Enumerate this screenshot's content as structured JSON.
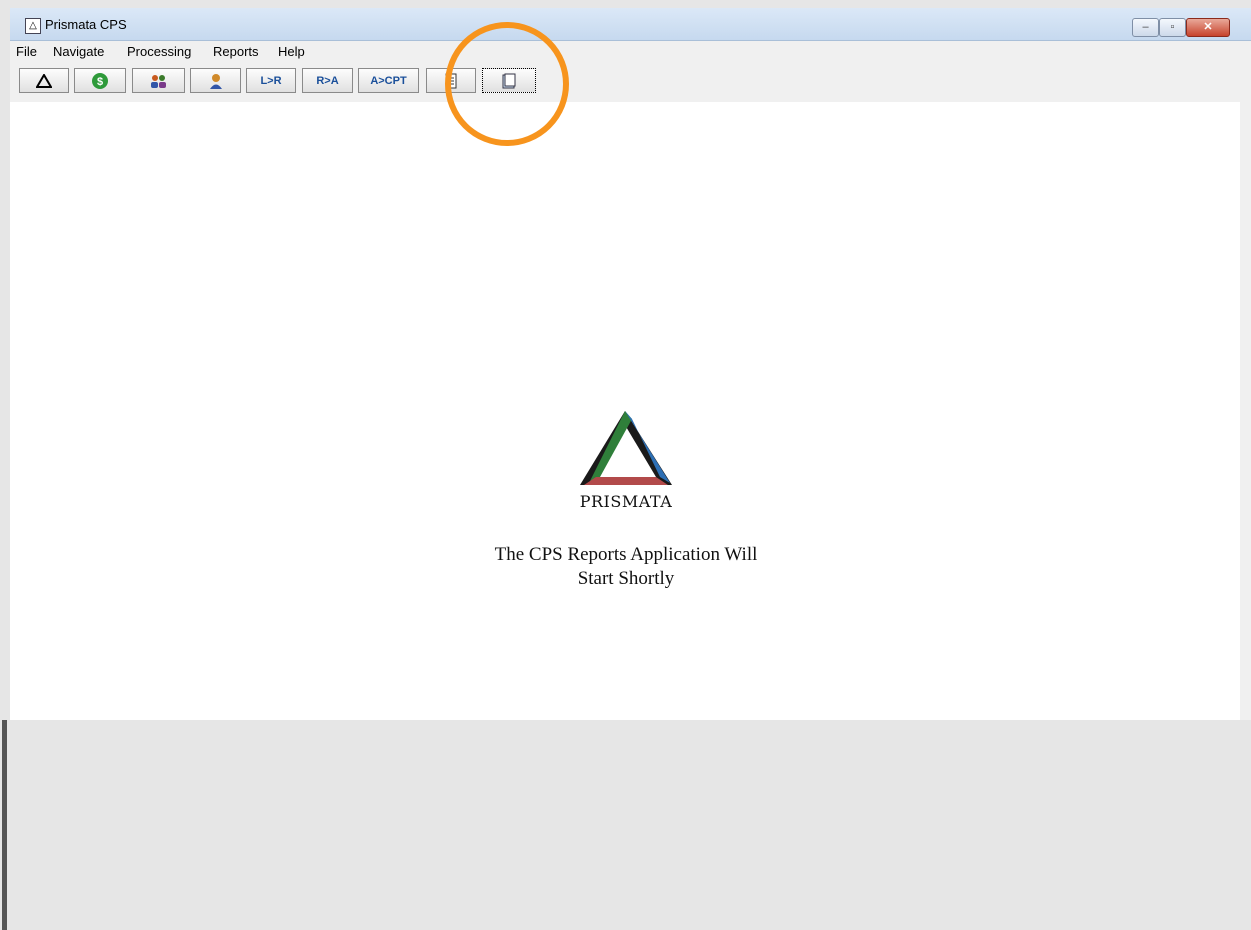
{
  "window": {
    "title": "Prismata CPS",
    "app_icon": "prismata-icon"
  },
  "window_controls": {
    "minimize": "minimize-icon",
    "maximize": "maximize-icon",
    "close": "close-icon"
  },
  "menu": [
    "File",
    "Navigate",
    "Processing",
    "Reports",
    "Help"
  ],
  "toolbar": [
    {
      "id": "prismata",
      "icon": "triangle-icon",
      "label": ""
    },
    {
      "id": "billing",
      "icon": "dollar-icon",
      "label": ""
    },
    {
      "id": "patients",
      "icon": "users-icon",
      "label": ""
    },
    {
      "id": "physicians",
      "icon": "person-icon",
      "label": ""
    },
    {
      "id": "l-to-r",
      "label": "L>R"
    },
    {
      "id": "r-to-a",
      "label": "R>A"
    },
    {
      "id": "a-to-cpt",
      "label": "A>CPT"
    },
    {
      "id": "doc1",
      "icon": "document-icon",
      "label": ""
    },
    {
      "id": "doc2",
      "icon": "page-icon",
      "label": ""
    }
  ],
  "splash": {
    "logo_text": "PRISMATA",
    "message_line1": "The CPS Reports Application Will",
    "message_line2": "Start Shortly"
  },
  "colors": {
    "annotation": "#f7941d",
    "toolbar_text": "#1a4f9a"
  }
}
